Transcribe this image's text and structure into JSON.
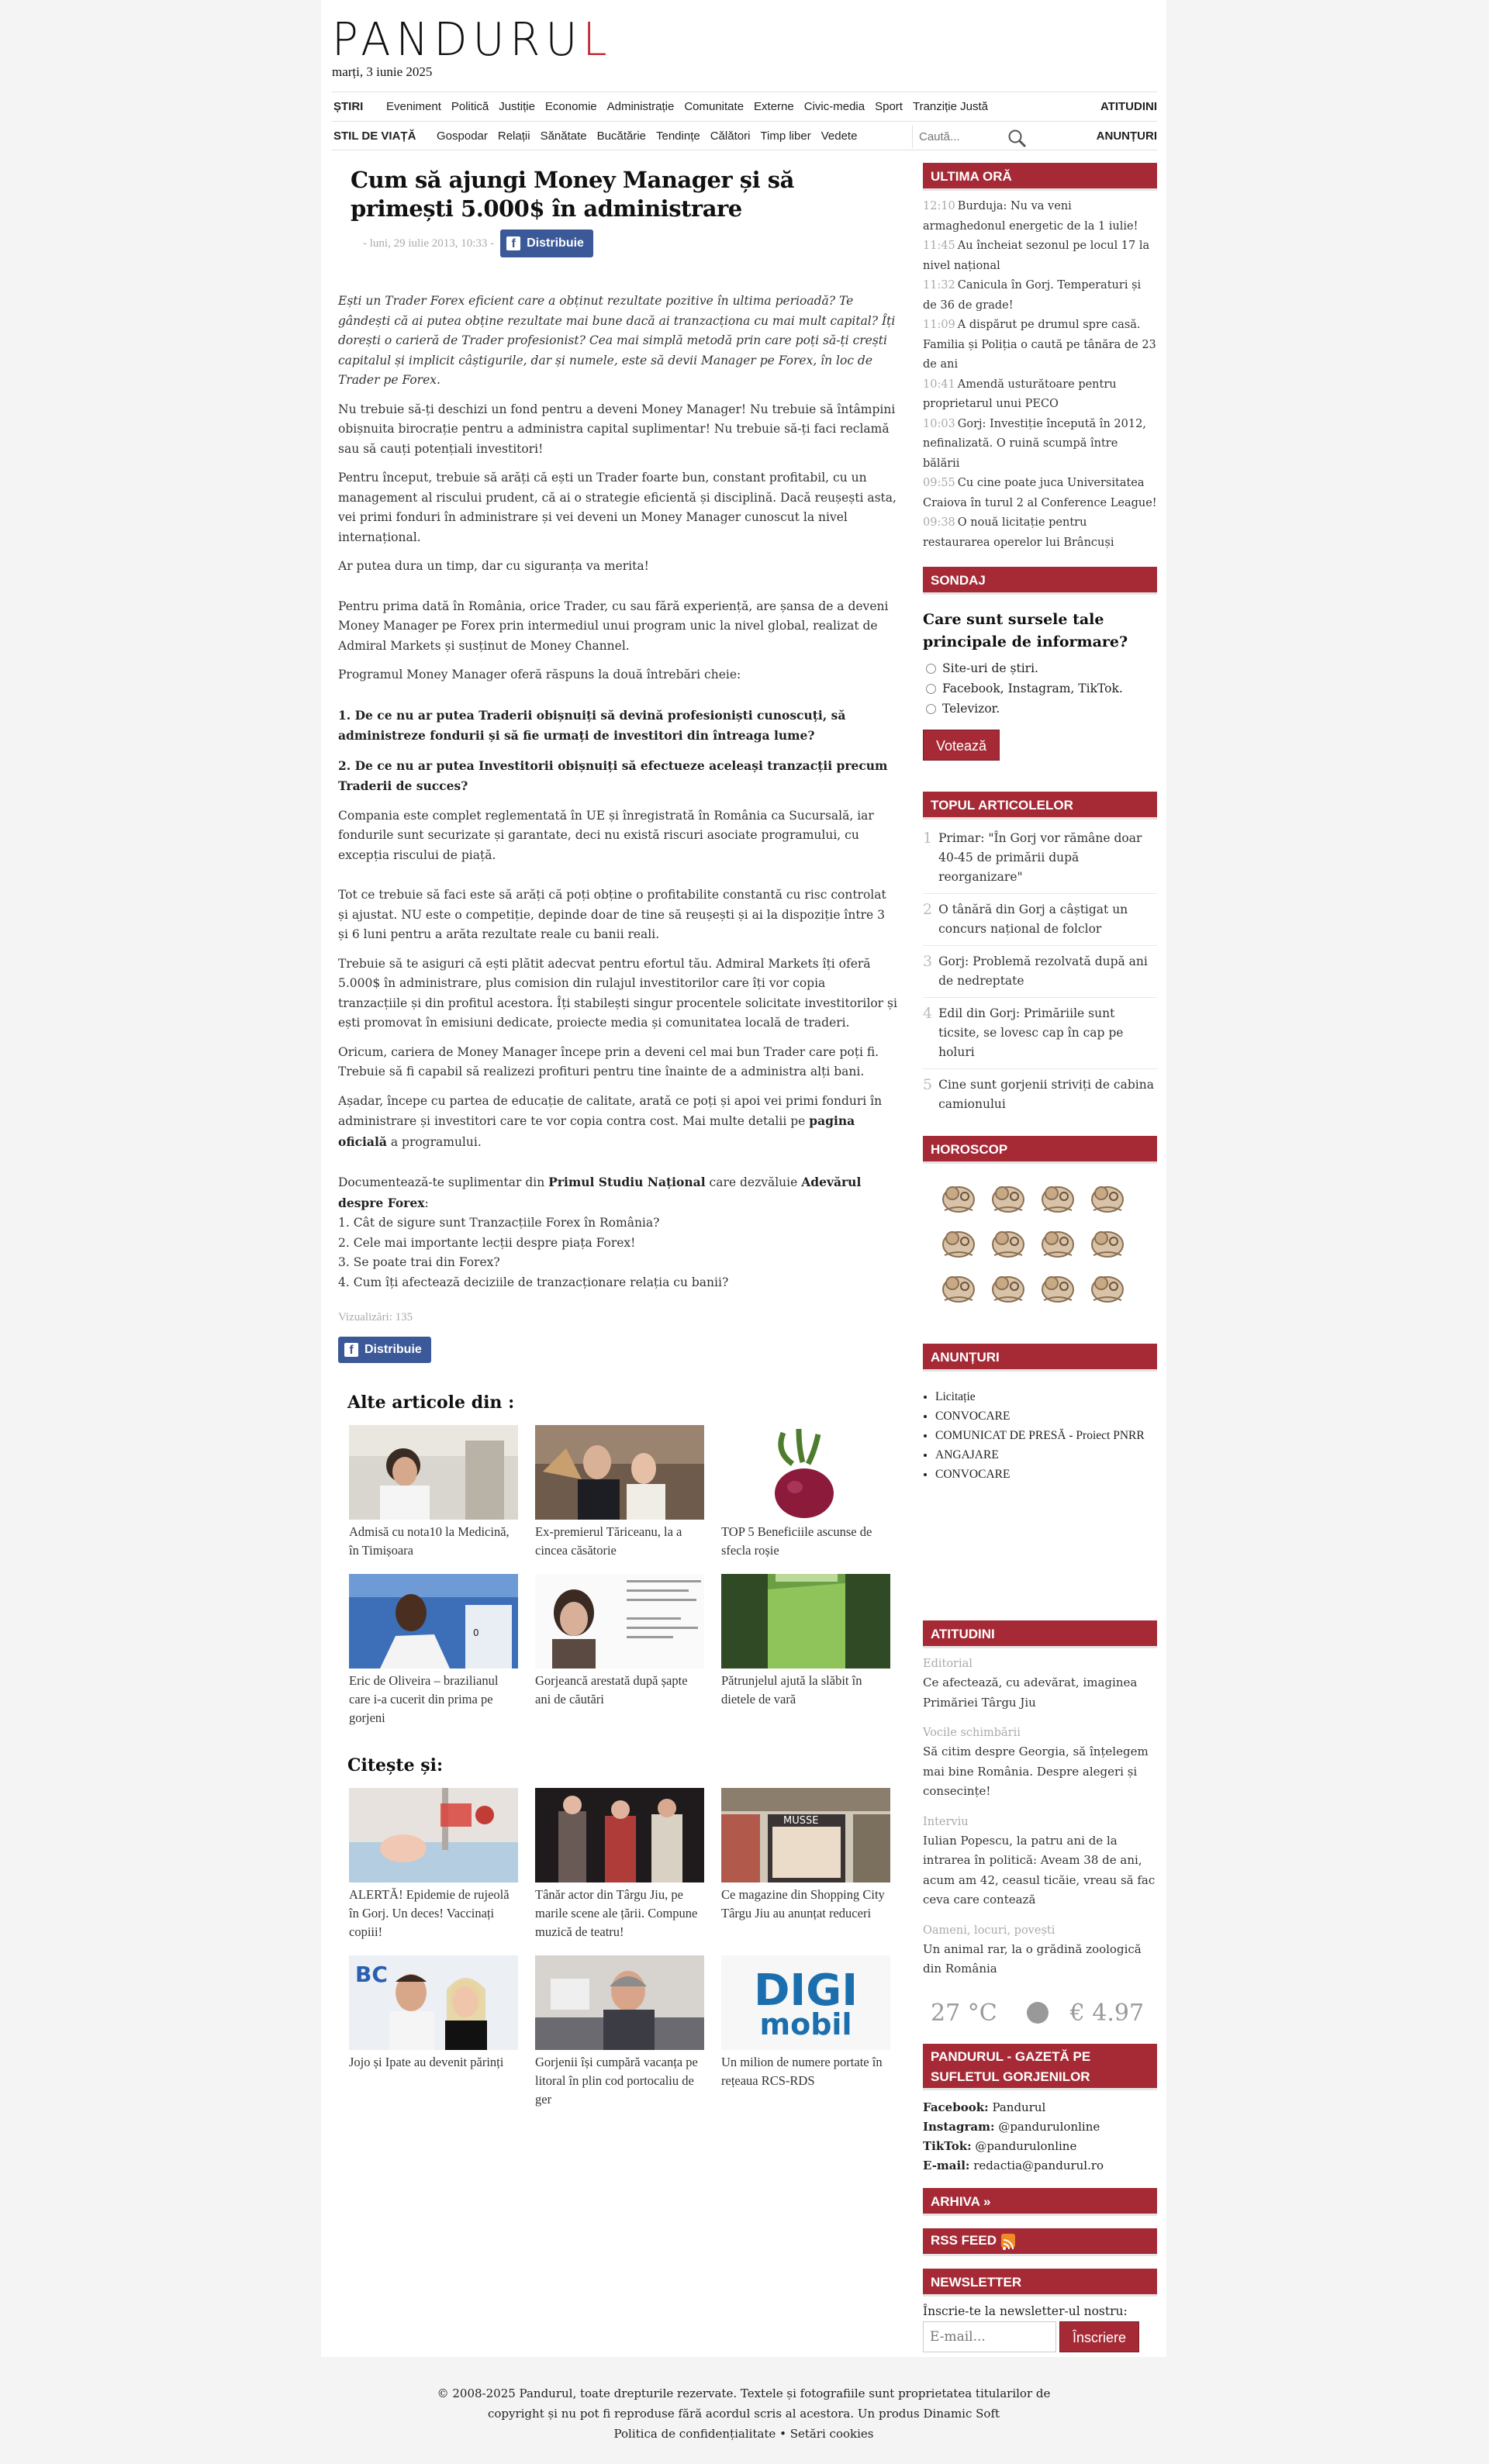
{
  "site": {
    "logo": "PANDURU",
    "logo_accent": "L",
    "date": "marți, 3 iunie 2025"
  },
  "nav": {
    "row1_lead": "ȘTIRI",
    "row1_items": [
      "Eveniment",
      "Politică",
      "Justiție",
      "Economie",
      "Administrație",
      "Comunitate",
      "Externe",
      "Civic-media",
      "Sport",
      "Tranziție Justă"
    ],
    "row1_right": "ATITUDINI",
    "row2_lead": "STIL DE VIAȚĂ",
    "row2_items": [
      "Gospodar",
      "Relații",
      "Sănătate",
      "Bucătărie",
      "Tendințe",
      "Călători",
      "Timp liber",
      "Vedete"
    ],
    "row2_right": "ANUNȚURI",
    "search_placeholder": "Caută..."
  },
  "article": {
    "title": "Cum să ajungi Money Manager și să primești 5.000$ în administrare",
    "meta": "- luni, 29 iulie 2013, 10:33 -",
    "share_label": "Distribuie",
    "lead": "Ești un Trader Forex eficient care a obținut rezultate pozitive în ultima perioadă? Te gândești că ai putea obține rezultate mai bune dacă ai tranzacționa cu mai mult capital? Îți dorești o carieră de Trader profesionist? Cea mai simplă metodă prin care poți să-ți crești capitalul și implicit câștigurile, dar și numele, este să devii Manager pe Forex, în loc de Trader pe Forex.",
    "p1": "Nu trebuie să-ți deschizi un fond pentru a deveni Money Manager! Nu trebuie să întâmpini obișnuita birocrație pentru a administra capital suplimentar! Nu trebuie să-ți faci reclamă sau să cauți potențiali investitori!",
    "p2": "Pentru început, trebuie să arăți că ești un Trader foarte bun, constant profitabil, cu un management al riscului prudent, că ai o strategie eficientă și disciplină. Dacă reușești asta, vei primi fonduri în administrare și vei deveni un Money Manager cunoscut la nivel internațional.",
    "p3": "Ar putea dura un timp, dar cu siguranța va merita!",
    "p4": "Pentru prima dată în România, orice Trader, cu sau fără experiență, are șansa de a deveni Money Manager pe Forex prin intermediul unui program unic la nivel global, realizat de Admiral Markets și susținut de Money Channel.",
    "p5": "Programul Money Manager oferă răspuns la două întrebări cheie:",
    "q1": "1. De ce nu ar putea Traderii obișnuiți să devină profesioniști cunoscuți, să administreze fondurii și să fie urmați de investitori din întreaga lume?",
    "q2": "2. De ce nu ar putea Investitorii obișnuiți să efectueze aceleași tranzacții precum Traderii de succes?",
    "p6": "Compania este complet reglementată în UE și înregistrată în România ca Sucursală, iar fondurile sunt securizate și garantate, deci nu există riscuri asociate programului, cu excepția riscului de piață.",
    "p7": "Tot ce trebuie să faci este să arăți că poți obține o profitabilite constantă cu risc controlat și ajustat. NU este o competiție, depinde doar de tine să reușești și ai la dispoziție între 3 și 6 luni pentru a arăta rezultate reale cu banii reali.",
    "p8": "Trebuie să te asiguri că ești plătit adecvat pentru efortul tău. Admiral Markets îți oferă 5.000$ în administrare, plus comision din rulajul investitorilor care îți vor copia tranzacțiile și din profitul acestora. Îți stabilești singur procentele solicitate investitorilor și ești promovat în emisiuni dedicate, proiecte media și comunitatea locală de traderi.",
    "p9": "Oricum, cariera de Money Manager începe prin a deveni cel mai bun Trader care poți fi. Trebuie să fi capabil să realizezi profituri pentru tine înainte de a administra alți bani.",
    "p10_a": "Așadar, începe cu partea de educație de calitate, arată ce poți și apoi vei primi fonduri în administrare și investitori care te vor copia contra cost. Mai multe detalii pe ",
    "p10_link": "pagina oficială",
    "p10_b": " a programului.",
    "p11_a": "Documentează-te suplimentar din ",
    "p11_link1": "Primul Studiu Național",
    "p11_b": " care dezvăluie ",
    "p11_link2": "Adevărul despre Forex",
    "p11_c": ":",
    "list": [
      "1. Cât de sigure sunt Tranzacțiile Forex în România?",
      "2. Cele mai importante lecții despre piața Forex!",
      "3. Se poate trai din Forex?",
      "4. Cum îți afectează deciziile de tranzacționare relația cu banii?"
    ],
    "views": "Vizualizări: 135"
  },
  "related": {
    "heading": "Alte articole din :",
    "items": [
      "Admisă cu nota10 la Medicină, în Timișoara",
      "Ex-premierul Tăriceanu, la a cincea căsătorie",
      "TOP 5 Beneficiile ascunse de sfecla roșie",
      "Eric de Oliveira – brazilianul care i-a cucerit din prima pe gorjeni",
      "Gorjeancă arestată după șapte ani de căutări",
      "Pătrunjelul ajută la slăbit în dietele de vară"
    ]
  },
  "read_also": {
    "heading": "Citește și:",
    "items": [
      "ALERTĂ! Epidemie de rujeolă în Gorj. Un deces! Vaccinați copiii!",
      "Tânăr actor din Târgu Jiu, pe marile scene ale țării. Compune muzică de teatru!",
      "Ce magazine din Shopping City Târgu Jiu au anunțat reduceri",
      "Jojo și Ipate au devenit părinți",
      "Gorjenii își cumpără vacanța pe litoral în plin cod portocaliu de ger",
      "Un milion de numere portate în rețeaua RCS-RDS"
    ],
    "mall_sign": "MUSSE",
    "digi_logo_top": "DIGI",
    "digi_logo_bottom": "mobil",
    "jojo_sign": "BC"
  },
  "sidebar": {
    "ultima_ora_title": "ULTIMA ORĂ",
    "ultima_ora": [
      {
        "time": "12:10",
        "title": "Burduja: Nu va veni armaghedonul energetic de la 1 iulie!"
      },
      {
        "time": "11:45",
        "title": "Au încheiat sezonul pe locul 17 la nivel național"
      },
      {
        "time": "11:32",
        "title": "Canicula în Gorj. Temperaturi și de 36 de grade!"
      },
      {
        "time": "11:09",
        "title": "A dispărut pe drumul spre casă. Familia și Poliția o caută pe tânăra de 23 de ani"
      },
      {
        "time": "10:41",
        "title": "Amendă usturătoare pentru proprietarul unui PECO"
      },
      {
        "time": "10:03",
        "title": "Gorj: Investiție începută în 2012, nefinalizată. O ruină scumpă între bălării"
      },
      {
        "time": "09:55",
        "title": "Cu cine poate juca Universitatea Craiova în turul 2 al Conference League!"
      },
      {
        "time": "09:38",
        "title": "O nouă licitație pentru restaurarea operelor lui Brâncuși"
      }
    ],
    "sondaj_title": "SONDAJ",
    "poll_question": "Care sunt sursele tale principale de informare?",
    "poll_options": [
      "Site-uri de știri.",
      "Facebook, Instagram, TikTok.",
      "Televizor."
    ],
    "vote_label": "Votează",
    "top_title": "TOPUL ARTICOLELOR",
    "top": [
      {
        "n": "1",
        "title": "Primar: \"În Gorj vor rămâne doar 40-45 de primării după reorganizare\""
      },
      {
        "n": "2",
        "title": "O tânără din Gorj a câștigat un concurs național de folclor"
      },
      {
        "n": "3",
        "title": "Gorj: Problemă rezolvată după ani de nedreptate"
      },
      {
        "n": "4",
        "title": "Edil din Gorj: Primăriile sunt ticsite, se lovesc cap în cap pe holuri"
      },
      {
        "n": "5",
        "title": "Cine sunt gorjenii striviți de cabina camionului"
      }
    ],
    "horoscop_title": "HOROSCOP",
    "zodiac": [
      "berbec",
      "taur",
      "gemeni",
      "rac",
      "leu",
      "fecioara",
      "balanta",
      "scorpion",
      "sagetator",
      "capricorn",
      "varsator",
      "pesti"
    ],
    "anunturi_title": "ANUNȚURI",
    "anunturi": [
      "Licitație",
      "CONVOCARE",
      "COMUNICAT DE PRESĂ - Proiect PNRR",
      "ANGAJARE",
      "CONVOCARE"
    ],
    "atitudini_title": "ATITUDINI",
    "atitudini": [
      {
        "cat": "Editorial",
        "title": "Ce afectează, cu adevărat, imaginea Primăriei Târgu Jiu"
      },
      {
        "cat": "Vocile schimbării",
        "title": "Să citim despre Georgia, să înțelegem mai bine România. Despre alegeri și consecințe!"
      },
      {
        "cat": "Interviu",
        "title": "Iulian Popescu, la patru ani de la intrarea în politică: Aveam 38 de ani, acum am 42, ceasul ticăie, vreau să fac ceva care contează"
      },
      {
        "cat": "Oameni, locuri, povești",
        "title": "Un animal rar, la o grădină zoologică din România"
      }
    ],
    "temperature": "27 °C",
    "eur": "€ 4.97",
    "gazeta_title": "PANDURUL - GAZETĂ PE SUFLETUL GORJENILOR",
    "facebook_label": "Facebook:",
    "facebook": "Pandurul",
    "instagram_label": "Instagram:",
    "instagram": "@pandurulonline",
    "tiktok_label": "TikTok:",
    "tiktok": "@pandurulonline",
    "email_label": "E-mail:",
    "email": "redactia@pandurul.ro",
    "arhiva": "ARHIVA »",
    "rss": "RSS FEED",
    "newsletter_title": "NEWSLETTER",
    "newsletter_label": "Înscrie-te la newsletter-ul nostru:",
    "email_placeholder": "E-mail...",
    "subscribe": "Înscriere"
  },
  "footer": {
    "line1": "© 2008-2025 Pandurul, toate drepturile rezervate. Textele și fotografiile sunt proprietatea titularilor de",
    "line2_a": "copyright și nu pot fi reproduse fără acordul scris al acestora. Un produs ",
    "line2_link": "Dinamic Soft",
    "privacy": "Politica de confidențialitate",
    "sep": " • ",
    "cookies": "Setări cookies"
  },
  "colors": {
    "accent": "#a52a36",
    "facebook": "#3b5998",
    "muted": "#aaaaaa"
  }
}
